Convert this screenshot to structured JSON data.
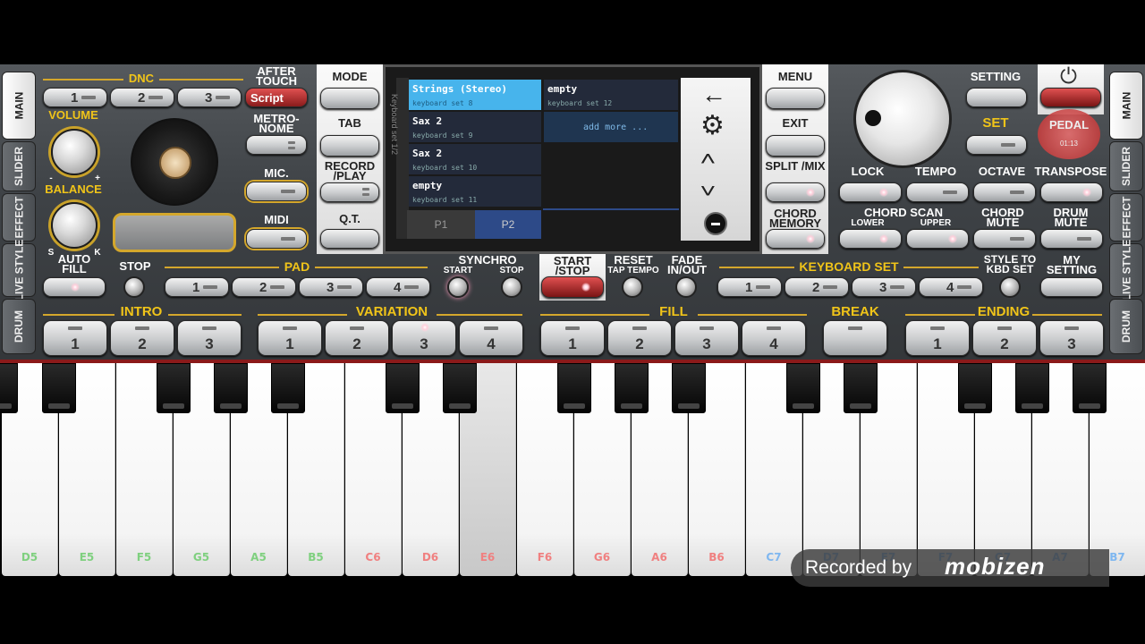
{
  "side_left": [
    "MAIN",
    "SLIDER",
    "EFFECT",
    "LIVE STYLE",
    "DRUM"
  ],
  "side_right": [
    "MAIN",
    "SLIDER",
    "EFFECT",
    "LIVE STYLE",
    "DRUM"
  ],
  "dnc": {
    "label": "DNC",
    "buttons": [
      "1",
      "2",
      "3"
    ],
    "script": "Script",
    "aftertouch": "AFTER TOUCH"
  },
  "volume": "VOLUME",
  "balance": "BALANCE",
  "balance_minus": "-",
  "balance_plus": "+",
  "balance_s": "S",
  "balance_k": "K",
  "metronome": "METRO- NOME",
  "mic": "MIC.",
  "midi": "MIDI",
  "left_menu": {
    "mode": "MODE",
    "tab": "TAB",
    "record": "RECORD /PLAY",
    "qt": "Q.T."
  },
  "screen": {
    "side_text": "Keyboard set 1/2",
    "items": [
      {
        "title": "Strings (Stereo)",
        "sub": "keyboard set 8"
      },
      {
        "title": "Sax 2",
        "sub": "keyboard set 9"
      },
      {
        "title": "Sax 2",
        "sub": "keyboard set 10"
      },
      {
        "title": "empty",
        "sub": "keyboard set 11"
      },
      {
        "title": "empty",
        "sub": "keyboard set 12"
      }
    ],
    "add_more": "add more ...",
    "pages": [
      "P1",
      "P2"
    ]
  },
  "right_menu": {
    "menu": "MENU",
    "exit": "EXIT",
    "split": "SPLIT /MIX",
    "chord_memory": "CHORD MEMORY"
  },
  "setting": "SETTING",
  "set": "SET",
  "pedal": "PEDAL",
  "pedal_time": "01:13",
  "row_controls": [
    "LOCK",
    "TEMPO",
    "OCTAVE",
    "TRANSPOSE"
  ],
  "chord_scan": "CHORD SCAN",
  "lower": "LOWER",
  "upper": "UPPER",
  "chord_mute": "CHORD MUTE",
  "drum_mute": "DRUM MUTE",
  "auto_fill": "AUTO FILL",
  "stop": "STOP",
  "pad": {
    "label": "PAD",
    "buttons": [
      "1",
      "2",
      "3",
      "4"
    ]
  },
  "synchro": "SYNCHRO",
  "synchro_start": "START",
  "synchro_stop": "STOP",
  "start_stop": "START /STOP",
  "reset": "RESET",
  "tap_tempo": "TAP TEMPO",
  "fade": "FADE IN/OUT",
  "keyboard_set": {
    "label": "KEYBOARD SET",
    "buttons": [
      "1",
      "2",
      "3",
      "4"
    ]
  },
  "style_to_kbd": "STYLE TO KBD SET",
  "my_setting": "MY SETTING",
  "intro": {
    "label": "INTRO",
    "buttons": [
      "1",
      "2",
      "3"
    ]
  },
  "variation": {
    "label": "VARIATION",
    "buttons": [
      "1",
      "2",
      "3",
      "4"
    ]
  },
  "fill": {
    "label": "FILL",
    "buttons": [
      "1",
      "2",
      "3",
      "4"
    ]
  },
  "break": {
    "label": "BREAK"
  },
  "ending": {
    "label": "ENDING",
    "buttons": [
      "1",
      "2",
      "3"
    ]
  },
  "keys": [
    {
      "n": "D5",
      "c": "#7fd07f"
    },
    {
      "n": "E5",
      "c": "#7fd07f"
    },
    {
      "n": "F5",
      "c": "#7fd07f"
    },
    {
      "n": "G5",
      "c": "#7fd07f"
    },
    {
      "n": "A5",
      "c": "#7fd07f"
    },
    {
      "n": "B5",
      "c": "#7fd07f"
    },
    {
      "n": "C6",
      "c": "#f08080"
    },
    {
      "n": "D6",
      "c": "#f08080"
    },
    {
      "n": "E6",
      "c": "#f08080"
    },
    {
      "n": "F6",
      "c": "#f08080"
    },
    {
      "n": "G6",
      "c": "#f08080"
    },
    {
      "n": "A6",
      "c": "#f08080"
    },
    {
      "n": "B6",
      "c": "#f08080"
    },
    {
      "n": "C7",
      "c": "#7fb7f0"
    },
    {
      "n": "D7",
      "c": "#7fb7f0"
    },
    {
      "n": "E7",
      "c": "#7fb7f0"
    },
    {
      "n": "F7",
      "c": "#7fb7f0"
    },
    {
      "n": "G7",
      "c": "#7fb7f0"
    },
    {
      "n": "A7",
      "c": "#7fb7f0"
    },
    {
      "n": "B7",
      "c": "#7fb7f0"
    }
  ],
  "watermark": {
    "prefix": "Recorded by",
    "brand": "mobizen"
  }
}
